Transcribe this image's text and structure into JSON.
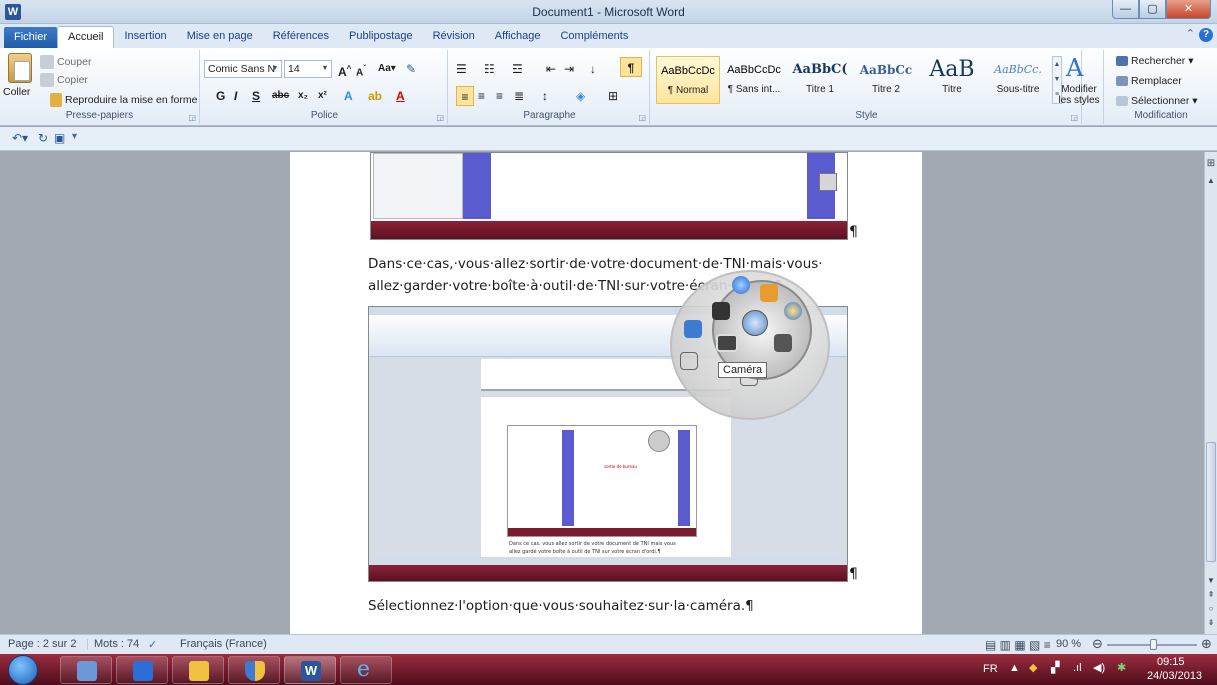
{
  "window": {
    "title": "Document1 - Microsoft Word",
    "app_icon": "W",
    "minimize": "—",
    "maximize": "▢",
    "close": "✕"
  },
  "tabs": [
    "Fichier",
    "Accueil",
    "Insertion",
    "Mise en page",
    "Références",
    "Publipostage",
    "Révision",
    "Affichage",
    "Compléments"
  ],
  "ribbon": {
    "clipboard": {
      "label": "Presse-papiers",
      "paste": "Coller",
      "cut": "Couper",
      "copy": "Copier",
      "format_painter": "Reproduire la mise en forme"
    },
    "font": {
      "label": "Police",
      "font_name": "Comic Sans N",
      "font_size": "14"
    },
    "paragraph": {
      "label": "Paragraphe"
    },
    "styles": {
      "label": "Style",
      "items": [
        {
          "sample": "AaBbCcDc",
          "name": "¶ Normal"
        },
        {
          "sample": "AaBbCcDc",
          "name": "¶ Sans int..."
        },
        {
          "sample": "AaBbC(",
          "name": "Titre 1"
        },
        {
          "sample": "AaBbCc",
          "name": "Titre 2"
        },
        {
          "sample": "AaB",
          "name": "Titre"
        },
        {
          "sample": "AaBbCc.",
          "name": "Sous-titre"
        }
      ],
      "change_styles": "Modifier les styles"
    },
    "editing": {
      "label": "Modification",
      "find": "Rechercher",
      "replace": "Remplacer",
      "select": "Sélectionner"
    }
  },
  "document": {
    "line1": "Dans·ce·cas,·vous·allez·sortir·de·votre·document·de·TNI·mais·vous·",
    "line2": "allez·garder·votre·boîte·à·outil·de·TNI·sur·votre·écran·d'ordi.¶",
    "line3": "Sélectionnez·l'option·que·vous·souhaitez·sur·la·caméra.¶",
    "pilcrow": "¶",
    "tooltip": "Caméra",
    "inner_text_1": "Dans ce cas, vous allez sortir de votre document de TNI mais vous",
    "inner_text_2": "allez gardé votre boîte à outil de TNI sur votre écran d'ordi.¶",
    "inner_label": "sortie de bureau"
  },
  "statusbar": {
    "page": "Page : 2 sur 2",
    "words": "Mots : 74",
    "language": "Français (France)",
    "zoom": "90 %",
    "zoom_value": 0.5
  },
  "taskbar": {
    "lang": "FR",
    "time": "09:15",
    "date": "24/03/2013"
  },
  "colors": {
    "accent": "#2b579a",
    "taskbar": "#6b1528",
    "purple_panel": "#5b5bd0"
  }
}
